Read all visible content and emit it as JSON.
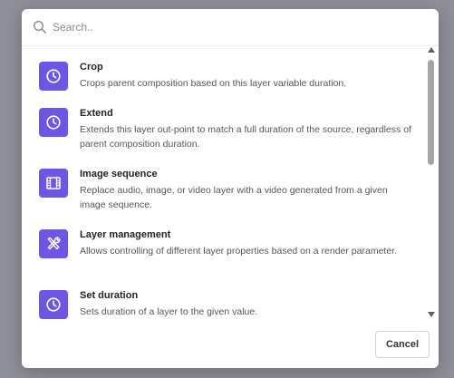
{
  "search": {
    "placeholder": "Search..",
    "value": ""
  },
  "items": [
    {
      "title": "Crop",
      "description": "Crops parent composition based on this layer variable duration.",
      "icon": "clock-icon"
    },
    {
      "title": "Extend",
      "description": "Extends this layer out-point to match a full duration of the source, regardless of parent composition duration.",
      "icon": "clock-icon"
    },
    {
      "title": "Image sequence",
      "description": "Replace audio, image, or video layer with a video generated from a given image sequence.",
      "icon": "film-icon"
    },
    {
      "title": "Layer management",
      "description": "Allows controlling of different layer properties based on a render parameter.",
      "icon": "tools-icon"
    },
    {
      "title": "Set duration",
      "description": "Sets duration of a layer to the given value.",
      "icon": "clock-icon"
    }
  ],
  "footer": {
    "cancel_label": "Cancel"
  },
  "colors": {
    "accent": "#6c56e6",
    "backdrop": "#8f8f99"
  }
}
